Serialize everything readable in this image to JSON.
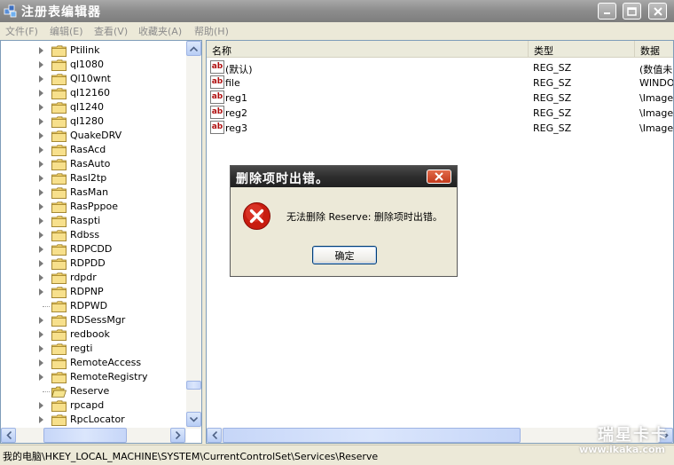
{
  "window": {
    "title": "注册表编辑器",
    "icon": "regedit-icon",
    "buttons": [
      "minimize",
      "maximize",
      "close"
    ]
  },
  "menubar": {
    "items": [
      "文件(F)",
      "编辑(E)",
      "查看(V)",
      "收藏夹(A)",
      "帮助(H)"
    ]
  },
  "tree": {
    "items": [
      {
        "label": "Ptilink"
      },
      {
        "label": "ql1080"
      },
      {
        "label": "Ql10wnt"
      },
      {
        "label": "ql12160"
      },
      {
        "label": "ql1240"
      },
      {
        "label": "ql1280"
      },
      {
        "label": "QuakeDRV"
      },
      {
        "label": "RasAcd"
      },
      {
        "label": "RasAuto"
      },
      {
        "label": "Rasl2tp"
      },
      {
        "label": "RasMan"
      },
      {
        "label": "RasPppoe"
      },
      {
        "label": "Raspti"
      },
      {
        "label": "Rdbss"
      },
      {
        "label": "RDPCDD"
      },
      {
        "label": "RDPDD"
      },
      {
        "label": "rdpdr"
      },
      {
        "label": "RDPNP"
      },
      {
        "label": "RDPWD"
      },
      {
        "label": "RDSessMgr"
      },
      {
        "label": "redbook"
      },
      {
        "label": "regti"
      },
      {
        "label": "RemoteAccess"
      },
      {
        "label": "RemoteRegistry"
      },
      {
        "label": "Reserve"
      },
      {
        "label": "rpcapd"
      },
      {
        "label": "RpcLocator"
      }
    ]
  },
  "list": {
    "columns": [
      "名称",
      "类型",
      "数据"
    ],
    "rows": [
      {
        "name": "(默认)",
        "type": "REG_SZ",
        "data": "(数值未"
      },
      {
        "name": "file",
        "type": "REG_SZ",
        "data": "WINDOW"
      },
      {
        "name": "reg1",
        "type": "REG_SZ",
        "data": "\\Image I"
      },
      {
        "name": "reg2",
        "type": "REG_SZ",
        "data": "\\Image I"
      },
      {
        "name": "reg3",
        "type": "REG_SZ",
        "data": "\\Image I"
      }
    ]
  },
  "dialog": {
    "title": "删除项时出错。",
    "message": "无法删除 Reserve: 删除项时出错。",
    "ok_label": "确定",
    "icon": "error-icon"
  },
  "statusbar": {
    "path": "我的电脑\\HKEY_LOCAL_MACHINE\\SYSTEM\\CurrentControlSet\\Services\\Reserve"
  },
  "watermark": {
    "main": "瑞星卡卡",
    "url": "www.ikaka.com"
  }
}
